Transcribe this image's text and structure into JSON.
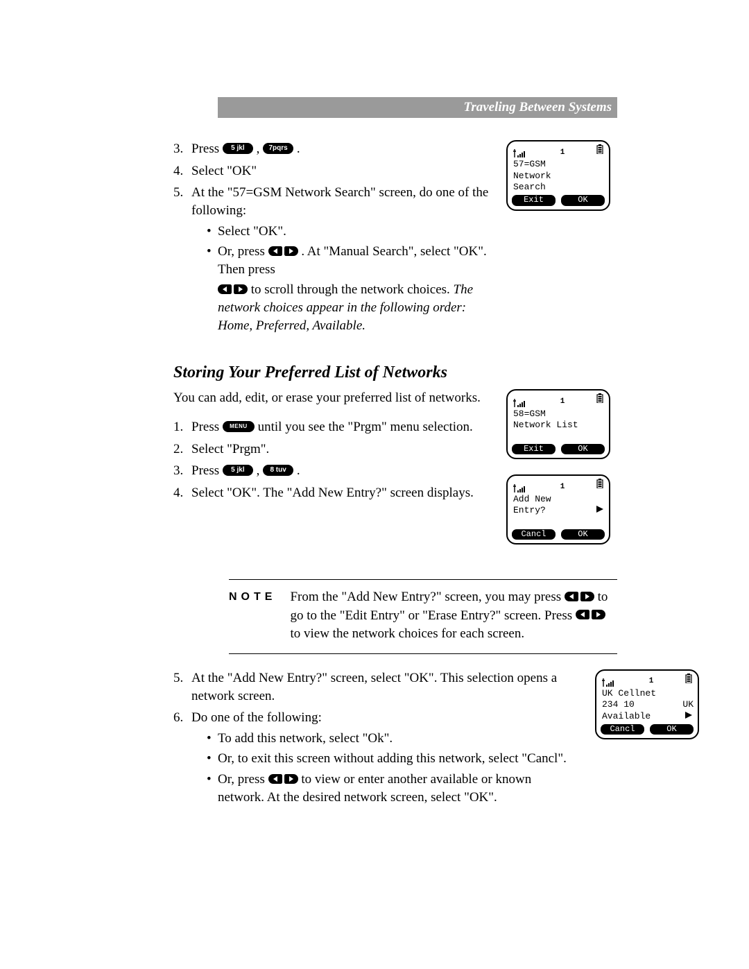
{
  "header": {
    "title": "Traveling Between Systems"
  },
  "keys": {
    "five": "5 jkl",
    "seven": "7pqrs",
    "eight": "8 tuv",
    "menu": "MENU"
  },
  "section1": {
    "step3_prefix": "Press ",
    "step3_mid": " , ",
    "step3_suffix": " .",
    "step4": "Select \"OK\"",
    "step5_lead": "At the \"57=GSM Network Search\" screen, do one of the following:",
    "step5_b1": "Select \"OK\".",
    "step5_b2a": "Or, press ",
    "step5_b2b": ". At \"Manual Search\", select \"OK\". Then press",
    "step5_b2c_a": " to scroll through the network choices. ",
    "step5_b2c_ital": "The network choices appear in the following order: Home, Preferred, Available."
  },
  "section2": {
    "heading": "Storing Your Preferred List of Networks",
    "intro": "You can add, edit, or erase your preferred list of networks.",
    "step1_a": "Press ",
    "step1_b": " until you see the \"Prgm\" menu selection.",
    "step2": "Select \"Prgm\".",
    "step3_prefix": "Press ",
    "step3_mid": " , ",
    "step3_suffix": " .",
    "step4": "Select \"OK\". The \"Add New Entry?\" screen displays."
  },
  "note": {
    "label": "NOTE",
    "line1_a": "From the \"Add New Entry?\" screen, you may press ",
    "line1_b": " to go to the \"Edit Entry\" or \"Erase Entry?\" screen. Press ",
    "line1_c": " to view the network choices for each screen."
  },
  "section3": {
    "step5": "At the \"Add New Entry?\" screen, select \"OK\". This selection opens a network screen.",
    "step6_lead": "Do one of the following:",
    "b1": "To add this network, select \"Ok\".",
    "b2": "Or, to exit this screen without adding this network, select \"Cancl\".",
    "b3_a": "Or, press ",
    "b3_b": " to view or enter another available or known network. At the desired network screen, select \"OK\"."
  },
  "phones": {
    "p1": {
      "status_num": "1",
      "l1": "57=GSM",
      "l2": "Network",
      "l3": "Search",
      "sk_left": "Exit",
      "sk_right": "OK"
    },
    "p2": {
      "status_num": "1",
      "l1": "58=GSM",
      "l2": "Network List",
      "l3": "",
      "sk_left": "Exit",
      "sk_right": "OK"
    },
    "p3": {
      "status_num": "1",
      "l1": "Add New",
      "l2": "Entry?",
      "l3": "",
      "sk_left": "Cancl",
      "sk_right": "OK"
    },
    "p4": {
      "status_num": "1",
      "l1": "UK Cellnet",
      "l2a": "234 10",
      "l2b": "UK",
      "l3": "Available",
      "sk_left": "Cancl",
      "sk_right": "OK"
    }
  }
}
